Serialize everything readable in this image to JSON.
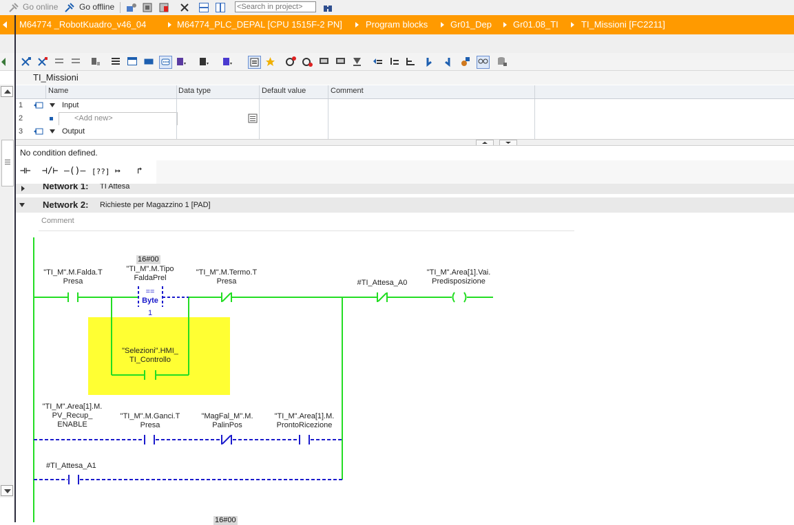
{
  "toolbar": {
    "go_online": "Go online",
    "go_offline": "Go offline",
    "search_placeholder": "<Search in project>"
  },
  "breadcrumb": [
    "M64774 _RobotKuadro_v46_04",
    "M64774_PLC_DEPAL [CPU 1515F-2 PN]",
    "Program blocks",
    "Gr01_Dep",
    "Gr01.08_TI",
    "TI_Missioni [FC2211]"
  ],
  "block": {
    "title": "TI_Missioni"
  },
  "interface": {
    "columns": [
      "Name",
      "Data type",
      "Default value",
      "Comment"
    ],
    "rows": [
      {
        "num": "1",
        "name": "Input"
      },
      {
        "num": "2",
        "name": "<Add new>"
      },
      {
        "num": "3",
        "name": "Output"
      }
    ]
  },
  "condition": {
    "text": "No condition defined."
  },
  "palette": [
    "⊣⊢",
    "⊣/⊢",
    "–()–",
    "[??]",
    "↦",
    "↱"
  ],
  "networks": {
    "net1": {
      "label": "Network 1:",
      "title": "TI Attesa"
    },
    "net2": {
      "label": "Network 2:",
      "title": "Richieste per Magazzino 1 [PAD]",
      "comment_placeholder": "Comment"
    }
  },
  "ladder": {
    "hex1": "16#00",
    "hex2": "16#00",
    "cmp_op": "==",
    "cmp_type": "Byte",
    "cmp_idx": "1",
    "op_falda": [
      "\"TI_M\".M.Falda.T",
      "Presa"
    ],
    "op_tipo": [
      "\"TI_M\".M.Tipo",
      "FaldaPrel"
    ],
    "op_termo": [
      "\"TI_M\".M.Termo.T",
      "Presa"
    ],
    "op_attesa_a0": "#TI_Attesa_A0",
    "op_area_vai": [
      "\"TI_M\".Area[1].Vai.",
      "Predisposizione"
    ],
    "op_selezioni": [
      "\"Selezioni\".HMI_",
      "TI_Controllo"
    ],
    "op_pvrecup": [
      "\"TI_M\".Area[1].M.",
      "PV_Recup_",
      "ENABLE"
    ],
    "op_ganci": [
      "\"TI_M\".M.Ganci.T",
      "Presa"
    ],
    "op_magfal": [
      "\"MagFal_M\".M.",
      "PalinPos"
    ],
    "op_pronto": [
      "\"TI_M\".Area[1].M.",
      "ProntoRicezione"
    ],
    "op_attesa_a1": "#TI_Attesa_A1"
  },
  "colors": {
    "accent": "#ff9a00",
    "ladder_green": "#22dd22",
    "ladder_blue": "#1a1acc",
    "highlight": "#ffff33"
  }
}
